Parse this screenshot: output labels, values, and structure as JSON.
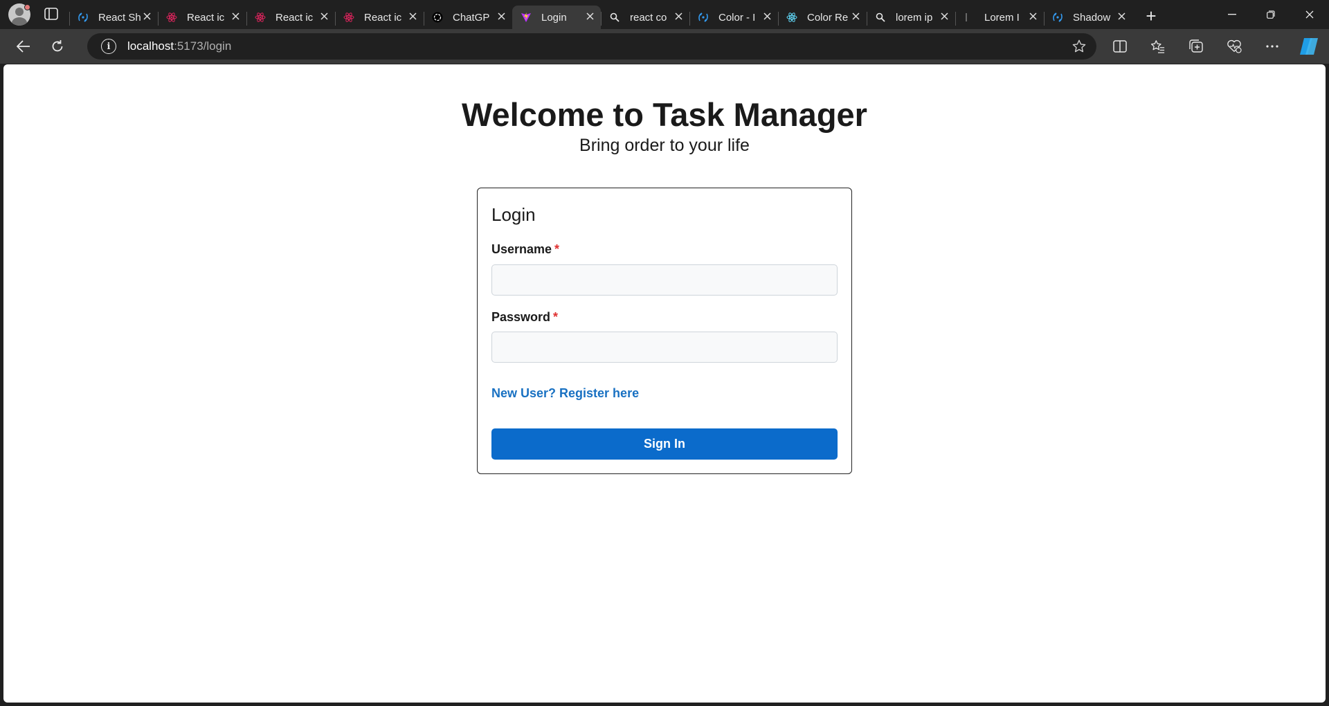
{
  "browser": {
    "tabs": [
      {
        "label": "React Sh",
        "icon": "mantine-icon",
        "color": "#339af0"
      },
      {
        "label": "React ic",
        "icon": "react-icons-icon",
        "color": "#e0245e"
      },
      {
        "label": "React ic",
        "icon": "react-icons-icon",
        "color": "#e0245e"
      },
      {
        "label": "React ic",
        "icon": "react-icons-icon",
        "color": "#e0245e"
      },
      {
        "label": "ChatGP",
        "icon": "chatgpt-icon",
        "color": "#ffffff"
      },
      {
        "label": "Login",
        "icon": "vite-icon",
        "color": "#bd34fe",
        "active": true
      },
      {
        "label": "react co",
        "icon": "search-icon",
        "color": "#e8e8e8"
      },
      {
        "label": "Color - I",
        "icon": "mantine-icon",
        "color": "#339af0"
      },
      {
        "label": "Color Re",
        "icon": "react-icon",
        "color": "#61dafb"
      },
      {
        "label": "lorem ip",
        "icon": "search-icon",
        "color": "#e8e8e8"
      },
      {
        "label": "Lorem I",
        "icon": "lorem-icon",
        "color": "#888888"
      },
      {
        "label": "Shadow",
        "icon": "mantine-icon",
        "color": "#339af0"
      }
    ],
    "url_host": "localhost",
    "url_path": ":5173/login"
  },
  "page": {
    "title": "Welcome to Task Manager",
    "subtitle": "Bring order to your life",
    "card_title": "Login",
    "username_label": "Username",
    "password_label": "Password",
    "required_mark": "*",
    "username_value": "",
    "password_value": "",
    "register_link": "New User? Register here",
    "signin_label": "Sign In"
  },
  "colors": {
    "primary": "#0b6bcb",
    "link": "#1971c2",
    "required": "#e03131"
  }
}
